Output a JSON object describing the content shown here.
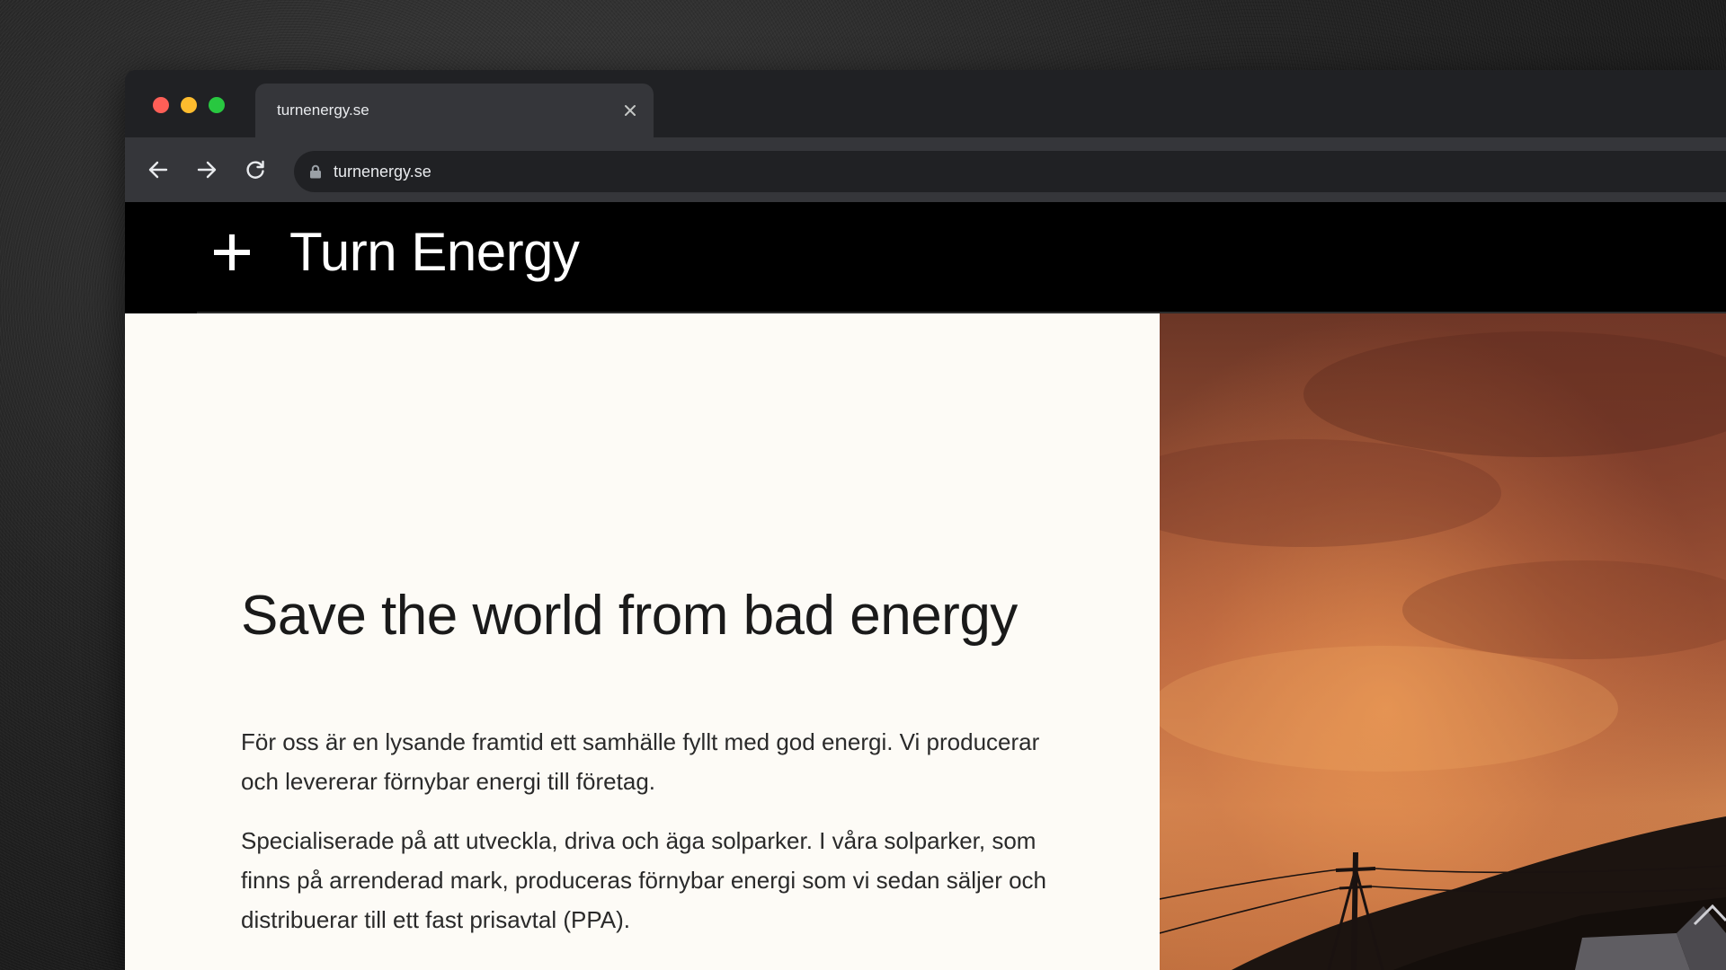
{
  "browser": {
    "tab_title": "turnenergy.se",
    "url": "turnenergy.se"
  },
  "site": {
    "brand": "Turn Energy",
    "hero": {
      "headline": "Save the world from bad energy",
      "paragraph_1": "För oss är en lysande framtid ett samhälle fyllt med god energi. Vi producerar och levererar förnybar energi till företag.",
      "paragraph_2": "Specialiserade på att utveckla, driva och äga solparker. I våra solparker, som finns på arrenderad mark, produceras förnybar energi som  vi sedan säljer och distribuerar till ett fast prisavtal (PPA)."
    }
  },
  "icons": {
    "back": "arrow-left-icon",
    "forward": "arrow-right-icon",
    "reload": "reload-icon",
    "lock": "lock-icon",
    "close": "close-icon",
    "logo": "plus-logo-icon"
  },
  "colors": {
    "traffic_red": "#fe5f57",
    "traffic_yellow": "#febc2e",
    "traffic_green": "#28c840",
    "header_bg": "#000000",
    "hero_bg": "#fdfbf6",
    "text": "#1a1a1a"
  }
}
